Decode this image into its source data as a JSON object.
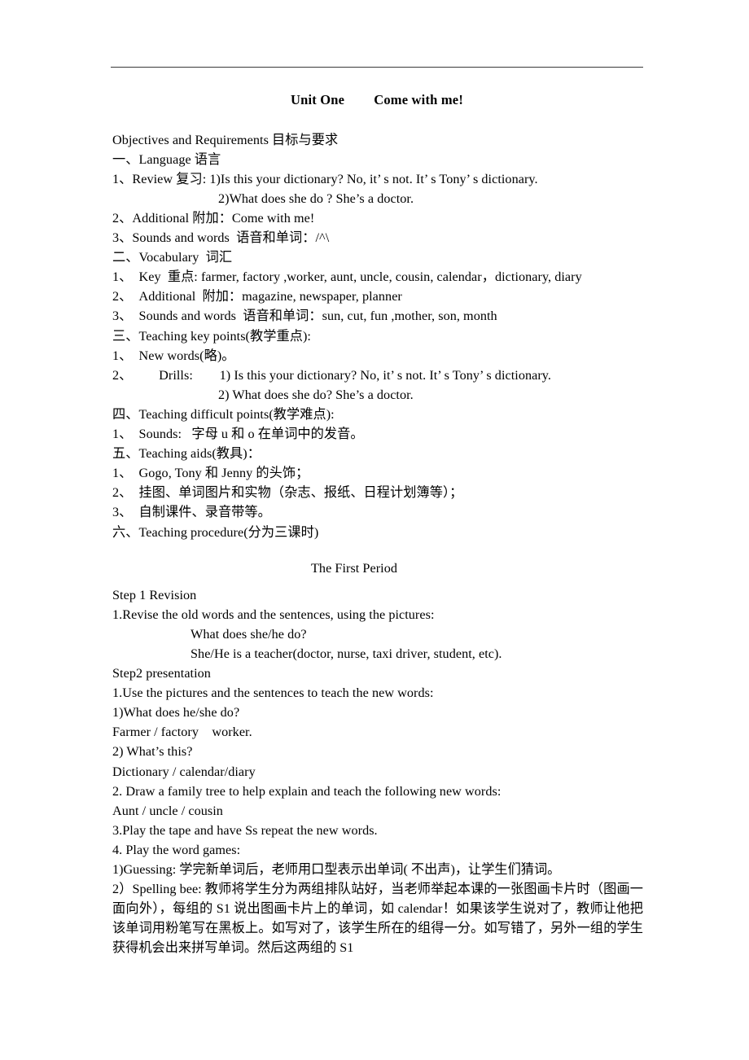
{
  "document": {
    "title_left": "Unit One",
    "title_right": "Come with me!",
    "section_heading": "The First Period"
  },
  "objectives": {
    "heading": "Objectives and Requirements 目标与要求",
    "language_heading": "一、Language 语言",
    "review_line1": "1、Review 复习: 1)Is this your dictionary? No, it’ s not. It’ s Tony’ s dictionary.",
    "review_line2": "2)What does she do ? She’s a doctor.",
    "additional": "2、Additional 附加：Come with me!",
    "sounds_words": "3、Sounds and words  语音和单词：/^\\"
  },
  "vocabulary": {
    "heading": "二、Vocabulary  词汇",
    "key": "1、　Key  重点: farmer, factory ,worker, aunt, uncle, cousin, calendar，dictionary, diary",
    "additional": "2、　Additional  附加：magazine, newspaper, planner",
    "sounds_words": "3、　Sounds and words  语音和单词：sun, cut, fun ,mother, son, month"
  },
  "key_points": {
    "heading": "三、Teaching key points(教学重点):",
    "new_words": "1、　New words(略)。",
    "drills_line1": "2、        Drills:        1) Is this your dictionary? No, it’ s not. It’ s Tony’ s dictionary.",
    "drills_line2": "2) What does she do? She’s a doctor."
  },
  "difficult_points": {
    "heading": "四、Teaching difficult points(教学难点):",
    "sounds": "1、　Sounds:   字母 u 和 o 在单词中的发音。"
  },
  "teaching_aids": {
    "heading": "五、Teaching aids(教具)：",
    "item1": "1、　Gogo, Tony 和 Jenny 的头饰；",
    "item2": "2、　挂图、单词图片和实物（杂志、报纸、日程计划簿等）；",
    "item3": "3、　自制课件、录音带等。"
  },
  "procedure": {
    "heading": "六、Teaching procedure(分为三课时)"
  },
  "first_period": {
    "step1_heading": "Step 1 Revision",
    "step1_item1": "1.Revise the old words and the sentences, using the pictures:",
    "step1_q": "What does she/he do?",
    "step1_a": "She/He is a teacher(doctor, nurse, taxi driver, student, etc).",
    "step2_heading": "Step2 presentation",
    "step2_item1": "1.Use the pictures and the sentences to teach the new words:",
    "step2_q1": "1)What does he/she do?",
    "step2_a1": "Farmer / factory    worker.",
    "step2_q2": "2) What’s this?",
    "step2_a2": "Dictionary / calendar/diary",
    "step2_item2": "2. Draw a family tree to help explain and teach the following new words:",
    "step2_a3": "Aunt / uncle / cousin",
    "step2_item3": "3.Play the tape and have Ss repeat the new words.",
    "step2_item4": "4. Play the word games:",
    "game1": "1)Guessing: 学完新单词后，老师用口型表示出单词( 不出声)，让学生们猜词。",
    "game2": "2）Spelling bee: 教师将学生分为两组排队站好，当老师举起本课的一张图画卡片时（图画一面向外），每组的 S1 说出图画卡片上的单词，如 calendar！如果该学生说对了，教师让他把该单词用粉笔写在黑板上。如写对了，该学生所在的组得一分。如写错了，另外一组的学生获得机会出来拼写单词。然后这两组的 S1"
  }
}
